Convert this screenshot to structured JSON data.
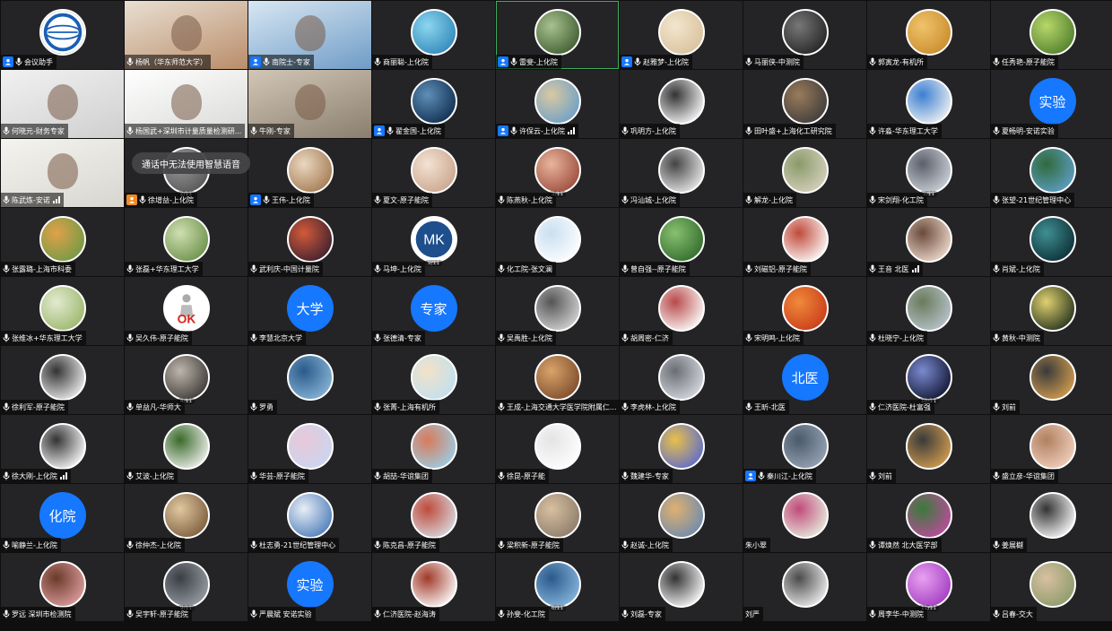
{
  "toast": "通话中无法使用智慧语音",
  "participants": [
    {
      "name": "会议助手",
      "kind": "logo",
      "host": true
    },
    {
      "name": "杨帆（华东师范大学）",
      "kind": "video",
      "colors": [
        "#b98d6a",
        "#e9dfd2"
      ]
    },
    {
      "name": "南院士-专家",
      "kind": "video",
      "colors": [
        "#6f9cc6",
        "#d8e7f3"
      ],
      "host": true
    },
    {
      "name": "商丽聪-上化院",
      "kind": "avatar",
      "colors": [
        "#2f86b9",
        "#8cd6ef"
      ]
    },
    {
      "name": "雷斐-上化院",
      "kind": "avatar",
      "colors": [
        "#3c5b2f",
        "#a9c18f"
      ],
      "host": true,
      "speaking": true
    },
    {
      "name": "赵雅梦-上化院",
      "kind": "avatar",
      "colors": [
        "#d9c09a",
        "#f2e6cf"
      ],
      "host": true
    },
    {
      "name": "马丽侠-中测院",
      "kind": "avatar",
      "colors": [
        "#222222",
        "#777777"
      ]
    },
    {
      "name": "郭寅龙-有机所",
      "kind": "avatar",
      "colors": [
        "#c88b2c",
        "#f0c36a"
      ]
    },
    {
      "name": "任秀艳-原子能院",
      "kind": "avatar",
      "colors": [
        "#4e7d2c",
        "#b8d76a"
      ]
    },
    {
      "name": "何晓元-财务专家",
      "kind": "video",
      "colors": [
        "#cfcfcf",
        "#f1f1f1"
      ]
    },
    {
      "name": "杨国武+深圳市计量质量检测研...",
      "kind": "video",
      "colors": [
        "#d8d8d6",
        "#ffffff"
      ]
    },
    {
      "name": "牛刚-专家",
      "kind": "video",
      "colors": [
        "#8a7e6e",
        "#d2c6b6"
      ]
    },
    {
      "name": "翟金国-上化院",
      "kind": "avatar",
      "colors": [
        "#0d2b4d",
        "#5f8fb8"
      ],
      "host": true
    },
    {
      "name": "许保云-上化院",
      "kind": "avatar",
      "colors": [
        "#6a9fc9",
        "#d9c8a2"
      ],
      "host": true,
      "signal": true
    },
    {
      "name": "巩明方-上化院",
      "kind": "avatar",
      "colors": [
        "#ffffff",
        "#333333"
      ]
    },
    {
      "name": "田叶盛+上海化工研究院",
      "kind": "avatar",
      "colors": [
        "#3b3b3b",
        "#9a7b5a"
      ]
    },
    {
      "name": "许淼-华东理工大学",
      "kind": "avatar",
      "colors": [
        "#f4f4f4",
        "#3b7fd1"
      ]
    },
    {
      "name": "夏畅明-安诺实验",
      "kind": "text",
      "label": "实验"
    },
    {
      "name": "陈武炼-安诺",
      "kind": "video",
      "colors": [
        "#d8d6d0",
        "#f4f3ef"
      ],
      "signal": true
    },
    {
      "name": "徐增益-上化院",
      "kind": "avatar",
      "colors": [
        "#555555",
        "#999999"
      ],
      "host": true,
      "hostOrange": true,
      "page": "2/11"
    },
    {
      "name": "王伟-上化院",
      "kind": "avatar",
      "colors": [
        "#a27850",
        "#ead8c0"
      ],
      "host": true
    },
    {
      "name": "夏文-原子能院",
      "kind": "avatar",
      "colors": [
        "#c9a48a",
        "#f3e2d4"
      ]
    },
    {
      "name": "陈燕秋-上化院",
      "kind": "avatar",
      "colors": [
        "#9a4a3a",
        "#e8b59c"
      ],
      "page": "3/11"
    },
    {
      "name": "冯汕城-上化院",
      "kind": "avatar",
      "colors": [
        "#eeeeee",
        "#444444"
      ]
    },
    {
      "name": "解龙-上化院",
      "kind": "avatar",
      "colors": [
        "#d8d2c0",
        "#8a9a6a"
      ]
    },
    {
      "name": "宋剑翔-化工院",
      "kind": "avatar",
      "colors": [
        "#d0d5dc",
        "#5a5f6a"
      ],
      "page": "5/11"
    },
    {
      "name": "张望-21世纪管理中心",
      "kind": "avatar",
      "colors": [
        "#5f9fc8",
        "#2f6a3a"
      ]
    },
    {
      "name": "张露璐-上海市科委",
      "kind": "avatar",
      "colors": [
        "#6e9a45",
        "#e0a14a"
      ]
    },
    {
      "name": "张磊+华东理工大学",
      "kind": "avatar",
      "colors": [
        "#6a8f4a",
        "#cfdfb0"
      ]
    },
    {
      "name": "武利庆-中国计量院",
      "kind": "avatar",
      "colors": [
        "#3a1f2f",
        "#d25a3a"
      ]
    },
    {
      "name": "马坤-上化院",
      "kind": "mk",
      "page": "9/11"
    },
    {
      "name": "化工院-张文澜",
      "kind": "avatar",
      "colors": [
        "#ffffff",
        "#c9dff0"
      ]
    },
    {
      "name": "曾自强--原子能院",
      "kind": "avatar",
      "colors": [
        "#2f6a2a",
        "#88c070"
      ]
    },
    {
      "name": "刘磁铝-原子能院",
      "kind": "avatar",
      "colors": [
        "#ffffff",
        "#c04a3a"
      ]
    },
    {
      "name": "王音 北医",
      "kind": "avatar",
      "colors": [
        "#f2ddd0",
        "#6a4a3a"
      ],
      "signal": true
    },
    {
      "name": "肖斌-上化院",
      "kind": "avatar",
      "colors": [
        "#0b2c33",
        "#3f8f93"
      ]
    },
    {
      "name": "张维冰+华东理工大学",
      "kind": "avatar",
      "colors": [
        "#9ab66a",
        "#e3ead0"
      ]
    },
    {
      "name": "吴久伟-原子能院",
      "kind": "ok"
    },
    {
      "name": "李慧北京大学",
      "kind": "text",
      "label": "大学"
    },
    {
      "name": "张德清-专家",
      "kind": "text",
      "label": "专家"
    },
    {
      "name": "吴禹胜-上化院",
      "kind": "avatar",
      "colors": [
        "#d7d7d7",
        "#555555"
      ]
    },
    {
      "name": "胡周密-仁济",
      "kind": "avatar",
      "colors": [
        "#ffffff",
        "#b84a4a"
      ]
    },
    {
      "name": "宋明鸣-上化院",
      "kind": "avatar",
      "colors": [
        "#c83a1a",
        "#f08a3a"
      ]
    },
    {
      "name": "杜晓宁-上化院",
      "kind": "avatar",
      "colors": [
        "#b9c6d0",
        "#6a7a5a"
      ]
    },
    {
      "name": "黄秋-中测院",
      "kind": "avatar",
      "colors": [
        "#1f2f1a",
        "#e0d070"
      ]
    },
    {
      "name": "徐利军-原子能院",
      "kind": "avatar",
      "colors": [
        "#f2f2f2",
        "#333333"
      ]
    },
    {
      "name": "单益凡-华师大",
      "kind": "avatar",
      "colors": [
        "#3a3633",
        "#bdb6ad"
      ],
      "page": "4/11"
    },
    {
      "name": "罗勇",
      "kind": "avatar",
      "colors": [
        "#8ab7d8",
        "#2a5a8a"
      ]
    },
    {
      "name": "张菁-上海有机所",
      "kind": "avatar",
      "colors": [
        "#bfe0f0",
        "#f2e2c8"
      ]
    },
    {
      "name": "王成-上海交通大学医学院附属仁...",
      "kind": "avatar",
      "colors": [
        "#7a4a2a",
        "#d9a36a"
      ]
    },
    {
      "name": "李虎林-上化院",
      "kind": "avatar",
      "colors": [
        "#d9dde3",
        "#6a6e74"
      ]
    },
    {
      "name": "王昕-北医",
      "kind": "text",
      "label": "北医"
    },
    {
      "name": "仁济医院-杜富强",
      "kind": "avatar",
      "colors": [
        "#0f1430",
        "#7a8ad0"
      ],
      "page": "10/11"
    },
    {
      "name": "刘前",
      "kind": "avatar",
      "colors": [
        "#d6a050",
        "#3a3a3a"
      ]
    },
    {
      "name": "徐大刚-上化院",
      "kind": "avatar",
      "colors": [
        "#ffffff",
        "#333333"
      ],
      "signal": true
    },
    {
      "name": "艾波-上化院",
      "kind": "avatar",
      "colors": [
        "#f4f4f4",
        "#3a6a2a"
      ]
    },
    {
      "name": "华芸-原子能院",
      "kind": "avatar",
      "colors": [
        "#c9d6f0",
        "#e8c8d8"
      ]
    },
    {
      "name": "胡喆-华谊集团",
      "kind": "avatar",
      "colors": [
        "#9ad0e8",
        "#d87a5a"
      ]
    },
    {
      "name": "徐昆-原子能",
      "kind": "avatar",
      "colors": [
        "#ffffff",
        "#e4e4e4"
      ]
    },
    {
      "name": "魏建华-专家",
      "kind": "avatar",
      "colors": [
        "#5a6ad0",
        "#e8c04a"
      ]
    },
    {
      "name": "秦川江-上化院",
      "kind": "avatar",
      "colors": [
        "#9aa6b8",
        "#4a5a6a"
      ],
      "host": true
    },
    {
      "name": "刘前",
      "kind": "avatar",
      "colors": [
        "#d6a050",
        "#3a3a3a"
      ]
    },
    {
      "name": "盛立彦-华谊集团",
      "kind": "avatar",
      "colors": [
        "#f3d2c0",
        "#b08060"
      ]
    },
    {
      "name": "喻静兰-上化院",
      "kind": "text",
      "label": "化院"
    },
    {
      "name": "徐仲杰-上化院",
      "kind": "avatar",
      "colors": [
        "#7a5a3a",
        "#e0c8a0"
      ]
    },
    {
      "name": "杜志勇-21世纪管理中心",
      "kind": "avatar",
      "colors": [
        "#4a7ab8",
        "#e8eef6"
      ]
    },
    {
      "name": "陈克昌-原子能院",
      "kind": "avatar",
      "colors": [
        "#d8dde4",
        "#c04a3a"
      ]
    },
    {
      "name": "梁积新-原子能院",
      "kind": "avatar",
      "colors": [
        "#8a7a6a",
        "#d8c0a0"
      ]
    },
    {
      "name": "赵诚-上化院",
      "kind": "avatar",
      "colors": [
        "#6a8ab0",
        "#e0b070"
      ]
    },
    {
      "name": "朱小翠",
      "kind": "avatar",
      "colors": [
        "#e8f0e0",
        "#c04a7a"
      ],
      "noMic": true
    },
    {
      "name": "谭焕然 北大医学部",
      "kind": "avatar",
      "colors": [
        "#c04aa0",
        "#3a7a3a"
      ]
    },
    {
      "name": "姜展樾",
      "kind": "avatar",
      "colors": [
        "#ffffff",
        "#333333"
      ]
    },
    {
      "name": "罗远 深圳市检测院",
      "kind": "avatar",
      "colors": [
        "#e0a0a0",
        "#6a3a2a"
      ]
    },
    {
      "name": "吴宇轩-原子能院",
      "kind": "avatar",
      "colors": [
        "#9aa0a6",
        "#3a3e44"
      ],
      "page": "9/11"
    },
    {
      "name": "严晨斌 安诺实验",
      "kind": "text",
      "label": "实验"
    },
    {
      "name": "仁济医院-赵海涛",
      "kind": "avatar",
      "colors": [
        "#ffffff",
        "#a03a2a"
      ]
    },
    {
      "name": "孙斐-化工院",
      "kind": "avatar",
      "colors": [
        "#8ab8e0",
        "#2a5a8a"
      ],
      "page": "6/11"
    },
    {
      "name": "刘磊-专家",
      "kind": "avatar",
      "colors": [
        "#ffffff",
        "#333333"
      ]
    },
    {
      "name": "刘严",
      "kind": "avatar",
      "colors": [
        "#f2f2f2",
        "#4a4a4a"
      ],
      "noMic": true
    },
    {
      "name": "周李华-中测院",
      "kind": "avatar",
      "colors": [
        "#a03ac0",
        "#e8a0f0"
      ],
      "page": "11/11"
    },
    {
      "name": "吕春-交大",
      "kind": "avatar",
      "colors": [
        "#8a9a6a",
        "#d8c0a0"
      ]
    }
  ]
}
